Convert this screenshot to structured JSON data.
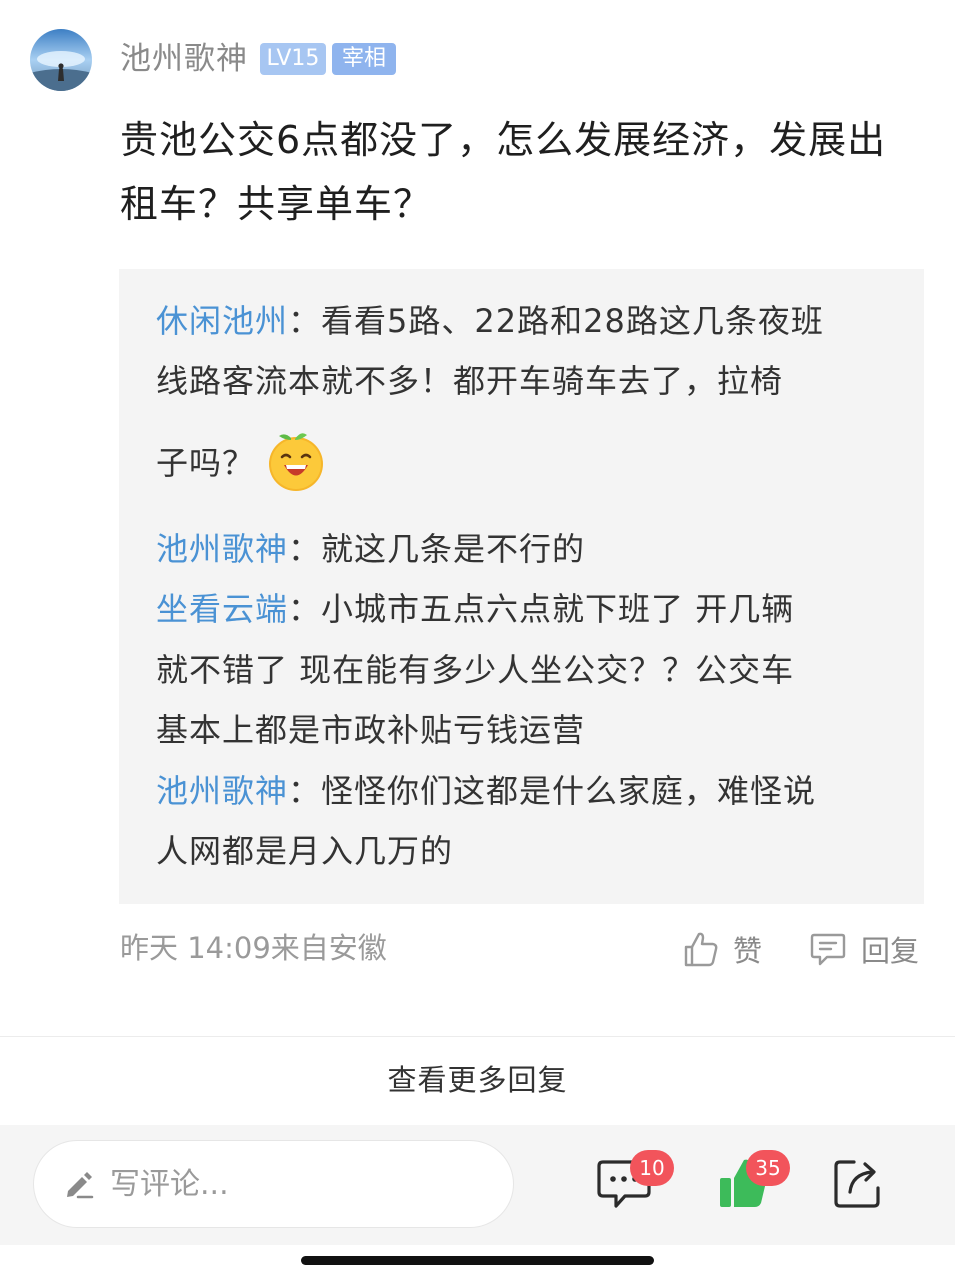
{
  "post": {
    "author": "池州歌神",
    "level_badge": "LV15",
    "title_badge": "宰相",
    "content": "贵池公交6点都没了，怎么发展经济，发展出租车？共享单车？",
    "timestamp": "昨天 14:09来自安徽",
    "like_label": "赞",
    "reply_label": "回复"
  },
  "replies": [
    {
      "name": "休闲池州",
      "lines": [
        "：看看5路、22路和28路这几条夜班",
        "线路客流本就不多！都开车骑车去了，拉椅",
        "子吗？"
      ],
      "emoji": "grinning-orange-emoji"
    },
    {
      "name": "池州歌神",
      "lines": [
        "：就这几条是不行的"
      ]
    },
    {
      "name": "坐看云端",
      "lines": [
        "：小城市五点六点就下班了 开几辆",
        "就不错了 现在能有多少人坐公交？？公交车",
        "基本上都是市政补贴亏钱运营"
      ]
    },
    {
      "name": "池州歌神",
      "lines": [
        "：怪怪你们这都是什么家庭，难怪说",
        "人网都是月入几万的"
      ]
    }
  ],
  "more_replies": "查看更多回复",
  "bottom_bar": {
    "comment_placeholder": "写评论...",
    "comment_count": "10",
    "like_count": "35",
    "icons": [
      "pen-icon",
      "comment-icon",
      "thumbs-up-icon",
      "share-icon"
    ]
  },
  "colors": {
    "name_blue": "#4a92d4",
    "badge_level": "#a7c6f2",
    "badge_title": "#8fb4ee",
    "like_green": "#3dbb5a",
    "count_red": "#f2545b"
  }
}
